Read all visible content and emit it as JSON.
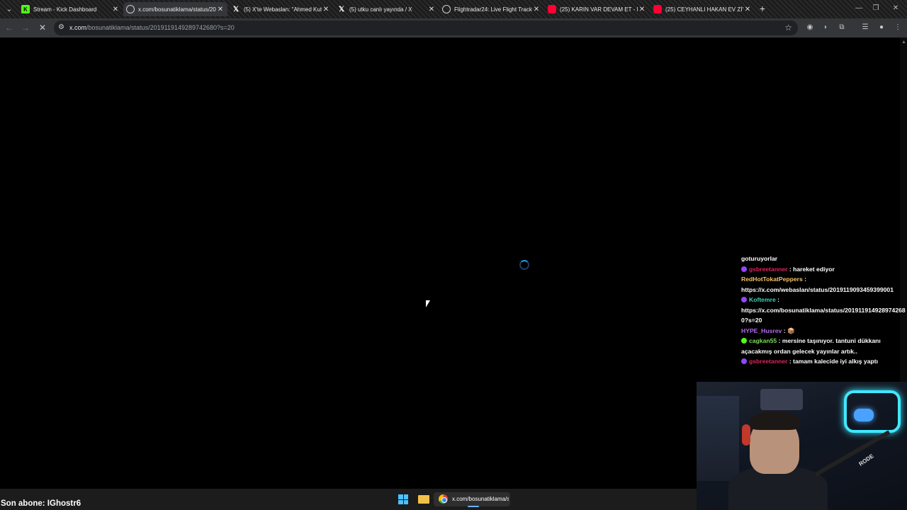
{
  "browser": {
    "tabs": [
      {
        "title": "Stream - Kick Dashboard",
        "icon": "kick-icon",
        "color": "#53fc18",
        "active": false
      },
      {
        "title": "x.com/bosunatiklama/status/20",
        "icon": "loading-icon",
        "color": "#cfcfcf",
        "active": true
      },
      {
        "title": "(5) X'te Webaslan: \"Ahmed Kut",
        "icon": "x-icon",
        "color": "#ffffff",
        "active": false
      },
      {
        "title": "(5) utku canlı yayında / X",
        "icon": "x-icon",
        "color": "#ffffff",
        "active": false
      },
      {
        "title": "Flightradar24: Live Flight Tracke",
        "icon": "globe-icon",
        "color": "#cfcfcf",
        "active": false
      },
      {
        "title": "(25) KARIN VAR DEVAM ET - M",
        "icon": "youtube-icon",
        "color": "#ff0033",
        "active": false
      },
      {
        "title": "(25) CEYHANLI HAKAN EV ZİYA",
        "icon": "youtube-icon",
        "color": "#ff0033",
        "active": false
      }
    ],
    "url_host": "x.com",
    "url_path": "/bosunatiklama/status/2019119149289742680?s=20"
  },
  "chat": {
    "messages": [
      {
        "user": "",
        "user_color": "#ffffff",
        "badge": "",
        "text": "goturuyorlar"
      },
      {
        "user": "gsbreetanner",
        "user_color": "#e0245e",
        "badge": "#9146ff",
        "text": " : hareket ediyor"
      },
      {
        "user": "RedHotTokatPeppers",
        "user_color": "#f5c26b",
        "badge": "",
        "text": " :"
      },
      {
        "user": "",
        "user_color": "#ffffff",
        "badge": "",
        "text": "https://x.com/webaslan/status/2019119093459399001"
      },
      {
        "user": "Koftemre",
        "user_color": "#3fd1b5",
        "badge": "#9146ff",
        "text": " :"
      },
      {
        "user": "",
        "user_color": "#ffffff",
        "badge": "",
        "text": "https://x.com/bosunatiklama/status/2019119149289742680?s=20"
      },
      {
        "user": "HYPE_Husrev",
        "user_color": "#b46cf0",
        "badge": "",
        "text": " : 📦"
      },
      {
        "user": "cagkan55",
        "user_color": "#7bdc5a",
        "badge": "#53fc18",
        "text": " : mersine taşınıyor. tantuni dükkanı açacakmış ordan gelecek yayınlar artık.."
      },
      {
        "user": "gsbreetanner",
        "user_color": "#e0245e",
        "badge": "#9146ff",
        "text": " : tamam kalecide iyi alkış yaptı"
      }
    ]
  },
  "webcam": {
    "mic_brand": "RODE"
  },
  "overlay": {
    "last_subscriber": "Son abone: IGhostr6"
  },
  "taskbar": {
    "chrome_label": "x.com/bosunatiklama/s"
  }
}
